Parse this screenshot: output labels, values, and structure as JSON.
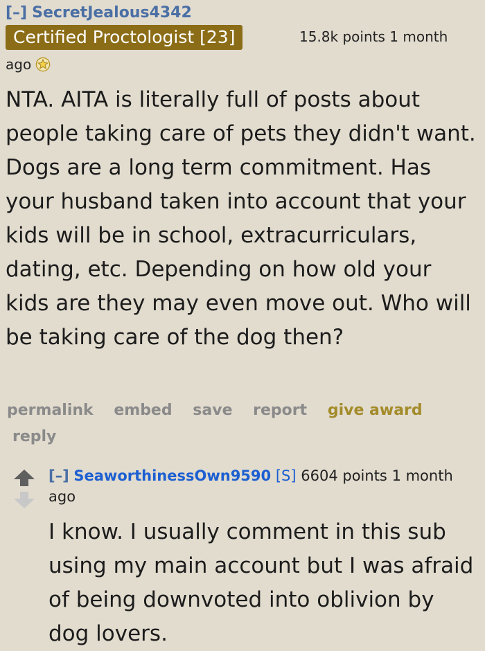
{
  "comment": {
    "collapse": "[–]",
    "author": "SecretJealous4342",
    "flair": "Certified Proctologist [23]",
    "score": "15.8k points",
    "time_part1": "1 month",
    "time_part2": "ago",
    "award_icon": "star-award-icon",
    "body": "NTA. AITA is literally full of posts about people taking care of pets they didn't want. Dogs are a long term commitment. Has your husband taken into account that your kids will be in school, extracurriculars, dating, etc. Depending on how old your kids are they may even move out. Who will be taking care of the dog then?",
    "buttons": {
      "permalink": "permalink",
      "embed": "embed",
      "save": "save",
      "report": "report",
      "give_award": "give award",
      "reply": "reply"
    }
  },
  "reply_comment": {
    "collapse": "[–]",
    "author": "SeaworthinessOwn9590",
    "submitter_tag": "[S]",
    "score": "6604 points",
    "time": "1 month ago",
    "body": "I know. I usually comment in this sub using my main account but I was afraid of being downvoted into oblivion by dog lovers."
  },
  "colors": {
    "background": "#e2dccf",
    "flair_bg": "#8c6d17",
    "author": "#4a6fa5",
    "reply_author": "#1c5fd1",
    "award_text": "#a38b2a"
  }
}
